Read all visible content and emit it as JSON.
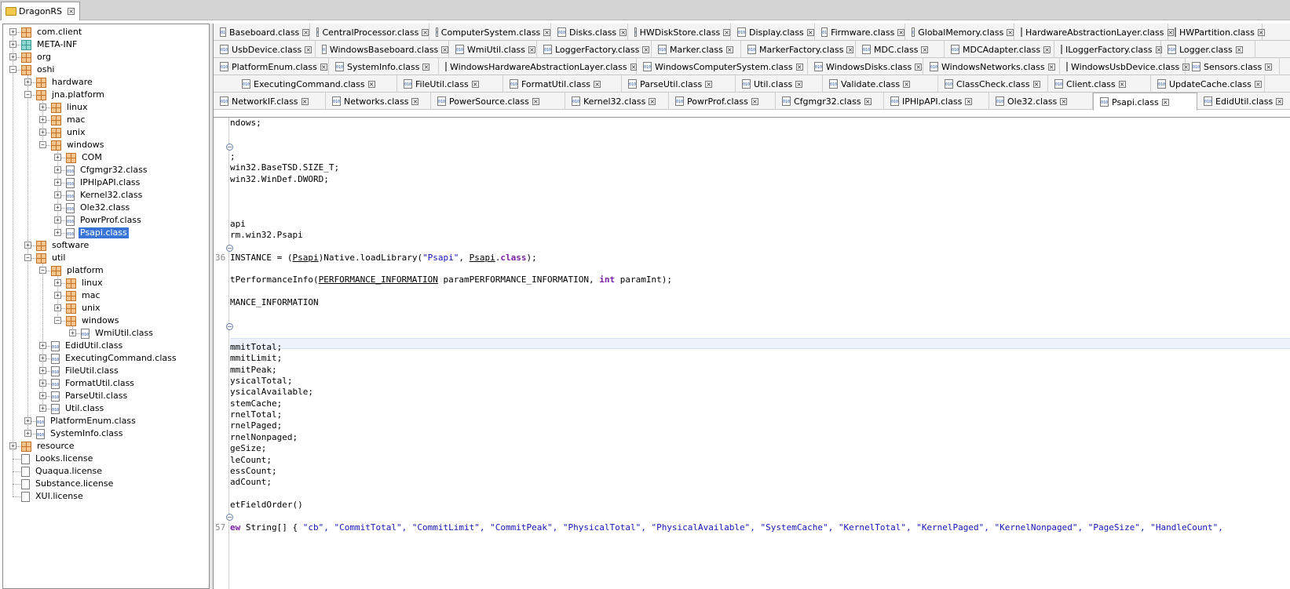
{
  "app": {
    "title": "DragonRS"
  },
  "tree": [
    {
      "label": "com.client",
      "icon": "package-icon",
      "depth": 0,
      "exp": "+"
    },
    {
      "label": "META-INF",
      "icon": "package-teal-icon",
      "depth": 0,
      "exp": "+"
    },
    {
      "label": "org",
      "icon": "package-icon",
      "depth": 0,
      "exp": "+"
    },
    {
      "label": "oshi",
      "icon": "package-icon",
      "depth": 0,
      "exp": "-"
    },
    {
      "label": "hardware",
      "icon": "package-icon",
      "depth": 1,
      "exp": "+"
    },
    {
      "label": "jna.platform",
      "icon": "package-icon",
      "depth": 1,
      "exp": "-"
    },
    {
      "label": "linux",
      "icon": "package-icon",
      "depth": 2,
      "exp": "+"
    },
    {
      "label": "mac",
      "icon": "package-icon",
      "depth": 2,
      "exp": "+"
    },
    {
      "label": "unix",
      "icon": "package-icon",
      "depth": 2,
      "exp": "+"
    },
    {
      "label": "windows",
      "icon": "package-icon",
      "depth": 2,
      "exp": "-"
    },
    {
      "label": "COM",
      "icon": "package-icon",
      "depth": 3,
      "exp": "+"
    },
    {
      "label": "Cfgmgr32.class",
      "icon": "class-icon",
      "depth": 3,
      "exp": "+"
    },
    {
      "label": "IPHlpAPI.class",
      "icon": "class-icon",
      "depth": 3,
      "exp": "+"
    },
    {
      "label": "Kernel32.class",
      "icon": "class-icon",
      "depth": 3,
      "exp": "+"
    },
    {
      "label": "Ole32.class",
      "icon": "class-icon",
      "depth": 3,
      "exp": "+"
    },
    {
      "label": "PowrProf.class",
      "icon": "class-icon",
      "depth": 3,
      "exp": "+"
    },
    {
      "label": "Psapi.class",
      "icon": "class-icon",
      "depth": 3,
      "exp": "+",
      "selected": true
    },
    {
      "label": "software",
      "icon": "package-icon",
      "depth": 1,
      "exp": "+"
    },
    {
      "label": "util",
      "icon": "package-icon",
      "depth": 1,
      "exp": "-"
    },
    {
      "label": "platform",
      "icon": "package-icon",
      "depth": 2,
      "exp": "-"
    },
    {
      "label": "linux",
      "icon": "package-icon",
      "depth": 3,
      "exp": "+"
    },
    {
      "label": "mac",
      "icon": "package-icon",
      "depth": 3,
      "exp": "+"
    },
    {
      "label": "unix",
      "icon": "package-icon",
      "depth": 3,
      "exp": "+"
    },
    {
      "label": "windows",
      "icon": "package-icon",
      "depth": 3,
      "exp": "-"
    },
    {
      "label": "WmiUtil.class",
      "icon": "class-icon",
      "depth": 4,
      "exp": "+"
    },
    {
      "label": "EdidUtil.class",
      "icon": "class-icon",
      "depth": 2,
      "exp": "+"
    },
    {
      "label": "ExecutingCommand.class",
      "icon": "class-icon",
      "depth": 2,
      "exp": "+"
    },
    {
      "label": "FileUtil.class",
      "icon": "class-icon",
      "depth": 2,
      "exp": "+"
    },
    {
      "label": "FormatUtil.class",
      "icon": "class-icon",
      "depth": 2,
      "exp": "+"
    },
    {
      "label": "ParseUtil.class",
      "icon": "class-icon",
      "depth": 2,
      "exp": "+"
    },
    {
      "label": "Util.class",
      "icon": "class-icon",
      "depth": 2,
      "exp": "+"
    },
    {
      "label": "PlatformEnum.class",
      "icon": "class-icon",
      "depth": 1,
      "exp": "+"
    },
    {
      "label": "SystemInfo.class",
      "icon": "class-icon",
      "depth": 1,
      "exp": "+"
    },
    {
      "label": "resource",
      "icon": "package-icon",
      "depth": 0,
      "exp": "+"
    },
    {
      "label": "Looks.license",
      "icon": "file-icon",
      "depth": 0,
      "exp": ""
    },
    {
      "label": "Quaqua.license",
      "icon": "file-icon",
      "depth": 0,
      "exp": ""
    },
    {
      "label": "Substance.license",
      "icon": "file-icon",
      "depth": 0,
      "exp": ""
    },
    {
      "label": "XUI.license",
      "icon": "file-icon",
      "depth": 0,
      "exp": ""
    }
  ],
  "tabs": [
    [
      "Baseboard.class",
      "CentralProcessor.class",
      "ComputerSystem.class",
      "Disks.class",
      "HWDiskStore.class",
      "Display.class",
      "Firmware.class",
      "GlobalMemory.class",
      "HardwareAbstractionLayer.class",
      "HWPartition.class"
    ],
    [
      "UsbDevice.class",
      "WindowsBaseboard.class",
      "WmiUtil.class",
      "LoggerFactory.class",
      "Marker.class",
      "MarkerFactory.class",
      "MDC.class",
      "MDCAdapter.class",
      "ILoggerFactory.class",
      "Logger.class"
    ],
    [
      "PlatformEnum.class",
      "SystemInfo.class",
      "WindowsHardwareAbstractionLayer.class",
      "WindowsComputerSystem.class",
      "WindowsDisks.class",
      "WindowsNetworks.class",
      "WindowsUsbDevice.class",
      "Sensors.class"
    ],
    [
      "ExecutingCommand.class",
      "FileUtil.class",
      "FormatUtil.class",
      "ParseUtil.class",
      "Util.class",
      "Validate.class",
      "ClassCheck.class",
      "Client.class",
      "UpdateCache.class"
    ],
    [
      "NetworkIF.class",
      "Networks.class",
      "PowerSource.class",
      "Kernel32.class",
      "PowrProf.class",
      "Cfgmgr32.class",
      "IPHlpAPI.class",
      "Ole32.class",
      "Psapi.class",
      "EdidUtil.class"
    ]
  ],
  "active_tab": "Psapi.class",
  "editor": {
    "line_numbers": [
      {
        "n": "36"
      },
      {
        "n": "57"
      }
    ],
    "lines": {
      "l1": "ndows;",
      "l2": ";",
      "l3": "win32.BaseTSD.SIZE_T;",
      "l4": "win32.WinDef.DWORD;",
      "l5": "api",
      "l6": "rm.win32.Psapi",
      "l7a": "INSTANCE = (",
      "l7b": "Psapi",
      "l7c": ")Native.loadLibrary(",
      "l7d": "\"Psapi\"",
      "l7e": ", ",
      "l7f": "Psapi",
      "l7g": ".",
      "l7h": "class",
      "l7i": ");",
      "l8a": "tPerformanceInfo(",
      "l8b": "PERFORMANCE_INFORMATION",
      "l8c": " paramPERFORMANCE_INFORMATION, ",
      "l8d": "int",
      "l8e": " paramInt);",
      "l9": "MANCE_INFORMATION",
      "f1": "mmitTotal;",
      "f2": "mmitLimit;",
      "f3": "mmitPeak;",
      "f4": "ysicalTotal;",
      "f5": "ysicalAvailable;",
      "f6": "stemCache;",
      "f7": "rnelTotal;",
      "f8": "rnelPaged;",
      "f9": "rnelNonpaged;",
      "f10": "geSize;",
      "f11": "leCount;",
      "f12": "essCount;",
      "f13": "adCount;",
      "l10": "etFieldOrder()",
      "l11a": "ew",
      "l11b": " String[] { ",
      "l11c": "\"cb\", \"CommitTotal\", \"CommitLimit\", \"CommitPeak\", \"PhysicalTotal\", \"PhysicalAvailable\", \"SystemCache\", \"KernelTotal\", \"KernelPaged\", \"KernelNonpaged\", \"PageSize\", \"HandleCount\","
    }
  }
}
